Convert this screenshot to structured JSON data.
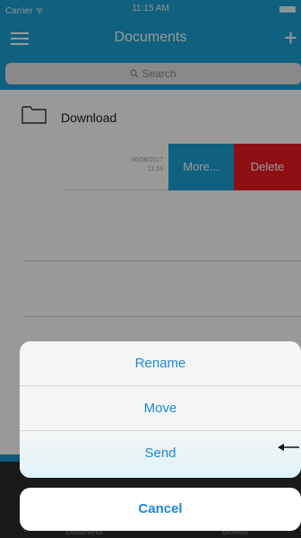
{
  "status_bar": {
    "carrier": "Carrier ᯤ",
    "time": "11:15 AM"
  },
  "nav": {
    "title": "Documents",
    "add_label": "+"
  },
  "search": {
    "placeholder": "Search"
  },
  "folder": {
    "label": "Download"
  },
  "file": {
    "date_line1": "06/28/2017",
    "date_line2": "11:13",
    "more_label": "More...",
    "delete_label": "Delete"
  },
  "tab_bar": {
    "tab_documents": "Documents",
    "tab_browser": "Browser"
  },
  "action_sheet": {
    "rename_label": "Rename",
    "move_label": "Move",
    "send_label": "Send",
    "cancel_label": "Cancel"
  },
  "colors": {
    "accent": "#1ba1d6",
    "delete": "#ec1c24",
    "action_text": "#1a8ad8"
  }
}
